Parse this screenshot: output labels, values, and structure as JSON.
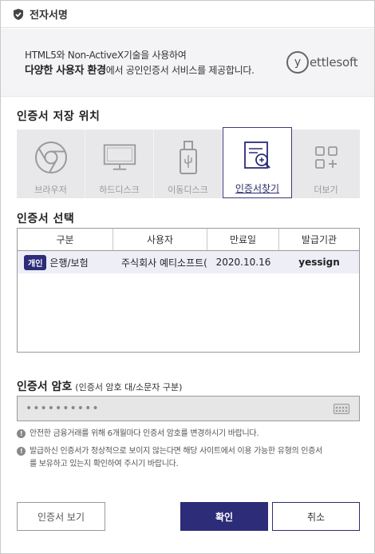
{
  "window": {
    "title": "전자서명"
  },
  "banner": {
    "line1": "HTML5와 Non-ActiveX기술을 사용하여",
    "line2_bold": "다양한 사용자 환경",
    "line2_rest": "에서 공인인증서 서비스를 제공합니다.",
    "logo_mark": "y",
    "logo_text": "ettlesoft"
  },
  "storage": {
    "label": "인증서 저장 위치",
    "items": [
      {
        "label": "브라우저",
        "icon": "chrome-icon"
      },
      {
        "label": "하드디스크",
        "icon": "monitor-icon"
      },
      {
        "label": "이동디스크",
        "icon": "usb-icon"
      },
      {
        "label": "인증서찾기",
        "icon": "certificate-search-icon",
        "active": true
      },
      {
        "label": "더보기",
        "icon": "more-grid-icon"
      }
    ]
  },
  "cert_select": {
    "label": "인증서 선택",
    "headers": [
      "구분",
      "사용자",
      "만료일",
      "발급기관"
    ],
    "rows": [
      {
        "badge": "개인",
        "type": "은행/보험",
        "user": "주식회사 예티소프트(",
        "expiry": "2020.10.16",
        "issuer": "yessign"
      }
    ]
  },
  "password": {
    "label": "인증서 암호",
    "hint": "(인증서 암호 대/소문자 구분)",
    "value": "••••••••••"
  },
  "notices": {
    "n1": "안전한 금융거래를 위해 6개월마다 인증서 암호를 변경하시기 바랍니다.",
    "n2_line1": "발급하신 인증서가 정상적으로 보이지 않는다면 해당 사이트에서 이용 가능한 유형의 인증서",
    "n2_line2": "를 보유하고 있는지 확인하여 주시기 바랍니다.",
    "icon": "!"
  },
  "buttons": {
    "view": "인증서 보기",
    "ok": "확인",
    "cancel": "취소"
  },
  "colors": {
    "accent": "#2c2c78",
    "panel": "#e8e8ea",
    "selected_row": "#eeeef7"
  }
}
